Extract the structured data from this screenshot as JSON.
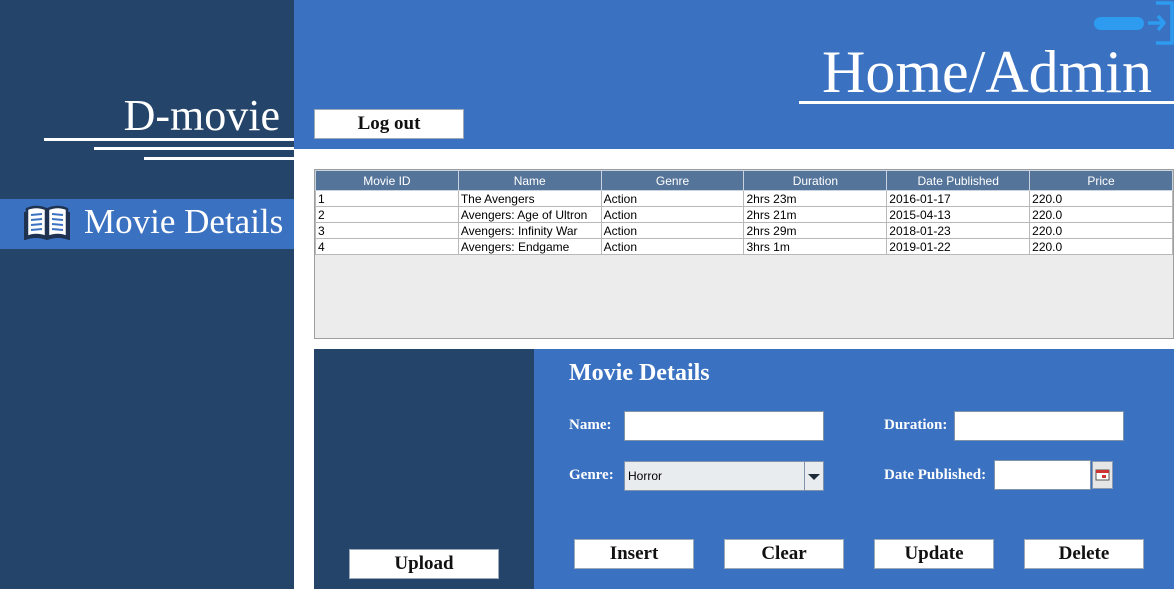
{
  "sidebar": {
    "brand": "D-movie",
    "nav_item": {
      "label": "Movie Details",
      "icon": "book-icon"
    }
  },
  "header": {
    "title": "Home/Admin",
    "logout_label": "Log out",
    "exit_icon": "exit-icon"
  },
  "table": {
    "columns": [
      "Movie ID",
      "Name",
      "Genre",
      "Duration",
      "Date Published",
      "Price"
    ],
    "rows": [
      [
        "1",
        "The Avengers",
        "Action",
        "2hrs 23m",
        "2016-01-17",
        "220.0"
      ],
      [
        "2",
        "Avengers: Age of Ultron",
        "Action",
        "2hrs 21m",
        "2015-04-13",
        "220.0"
      ],
      [
        "3",
        "Avengers: Infinity War",
        "Action",
        "2hrs 29m",
        "2018-01-23",
        "220.0"
      ],
      [
        "4",
        "Avengers: Endgame",
        "Action",
        "3hrs 1m",
        "2019-01-22",
        "220.0"
      ]
    ]
  },
  "form": {
    "title": "Movie Details",
    "name_label": "Name:",
    "name_value": "",
    "duration_label": "Duration:",
    "duration_value": "",
    "genre_label": "Genre:",
    "genre_value": "Horror",
    "date_label": "Date Published:",
    "date_value": "",
    "upload_label": "Upload",
    "insert_label": "Insert",
    "clear_label": "Clear",
    "update_label": "Update",
    "delete_label": "Delete"
  },
  "colors": {
    "sidebar_bg": "#25446a",
    "accent_bg": "#3a71c1",
    "header_row": "#55749a",
    "toggle": "#2d9bf0"
  }
}
